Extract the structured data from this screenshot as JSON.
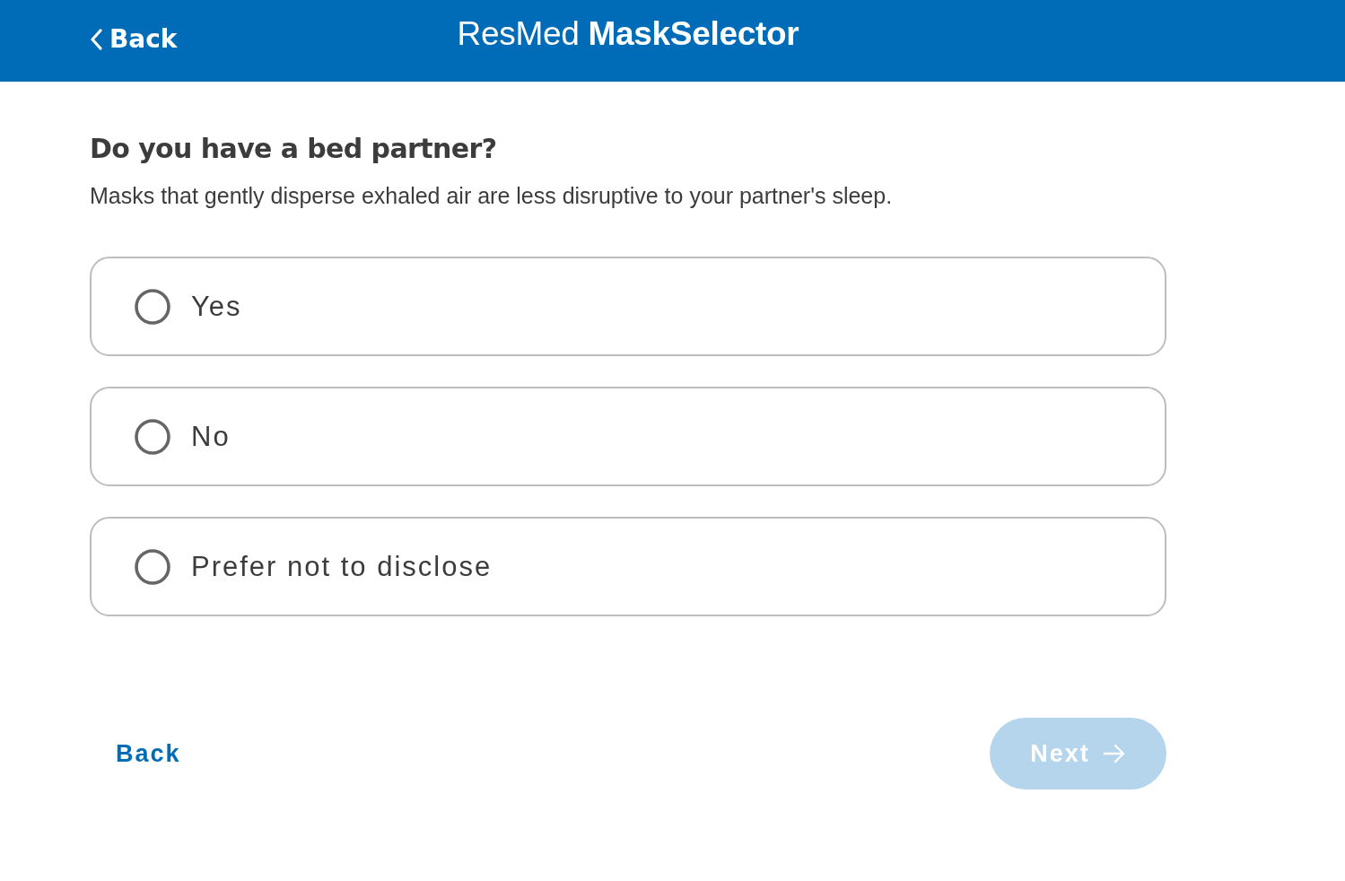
{
  "header": {
    "back_label": "Back",
    "title": "ResMed **MaskSelector**"
  },
  "question": {
    "title": "Do you have a bed partner?",
    "description": "Masks that gently disperse exhaled air are less disruptive to your partner's sleep."
  },
  "options": [
    {
      "label": "Yes",
      "selected": false
    },
    {
      "label": "No",
      "selected": false
    },
    {
      "label": "Prefer not to disclose",
      "selected": false
    }
  ],
  "footer": {
    "back_label": "Back",
    "next": {
      "label": "Next",
      "disabled": true
    }
  }
}
